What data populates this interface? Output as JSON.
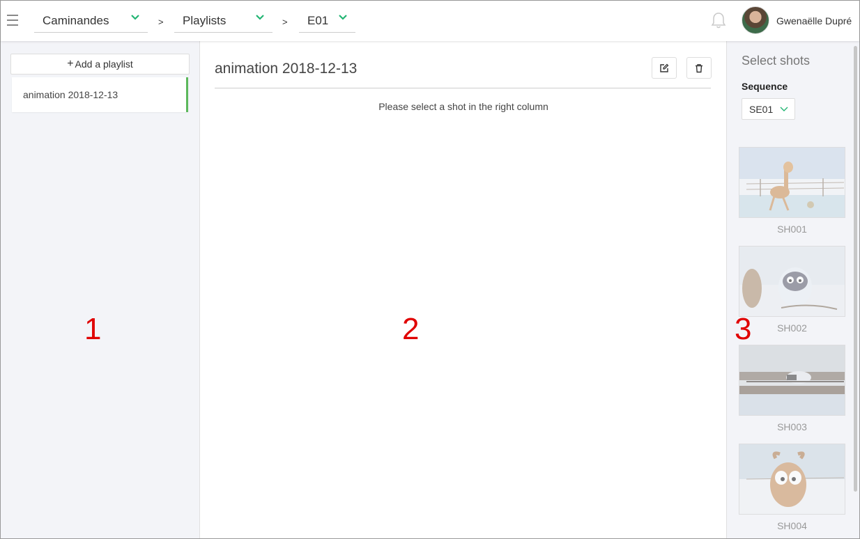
{
  "topbar": {
    "breadcrumbs": [
      {
        "label": "Caminandes"
      },
      {
        "label": "Playlists"
      },
      {
        "label": "E01"
      }
    ],
    "separator": ">",
    "user_name": "Gwenaëlle Dupré"
  },
  "left": {
    "add_label": "Add a playlist",
    "playlists": [
      {
        "label": "animation 2018-12-13"
      }
    ]
  },
  "middle": {
    "title": "animation 2018-12-13",
    "hint": "Please select a shot in the right column"
  },
  "right": {
    "heading": "Select shots",
    "sequence_label": "Sequence",
    "sequence_value": "SE01",
    "shots": [
      {
        "name": "SH001"
      },
      {
        "name": "SH002"
      },
      {
        "name": "SH003"
      },
      {
        "name": "SH004"
      }
    ]
  },
  "annotations": [
    "1",
    "2",
    "3"
  ],
  "colors": {
    "accent_green": "#5cb85c",
    "chevron_green": "#22b573",
    "annotation_red": "#e00000",
    "panel_bg": "#f3f4f8"
  },
  "icons": [
    "hamburger-icon",
    "chevron-down-icon",
    "bell-icon",
    "plus-icon",
    "edit-icon",
    "trash-icon"
  ]
}
